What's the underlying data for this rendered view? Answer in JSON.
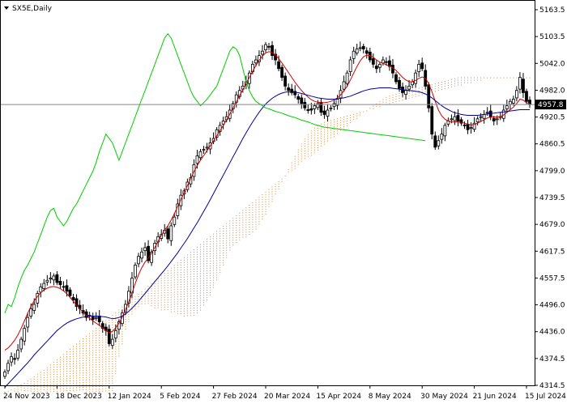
{
  "chart_data": {
    "type": "candlestick",
    "title": "SX5E,Daily",
    "current_price_label": "4957.8",
    "current_price": 4957.8,
    "ylim": [
      4314.5,
      5175.0
    ],
    "y_ticks": [
      "5163.5",
      "5103.5",
      "5042.0",
      "4982.0",
      "4920.5",
      "4860.5",
      "4799.0",
      "4739.5",
      "4679.0",
      "4617.5",
      "4557.5",
      "4496.0",
      "4436.0",
      "4374.5",
      "4314.5"
    ],
    "x_ticks": [
      "24 Nov 2023",
      "18 Dec 2023",
      "12 Jan 2024",
      "5 Feb 2024",
      "27 Feb 2024",
      "20 Mar 2024",
      "15 Apr 2024",
      "8 May 2024",
      "30 May 2024",
      "21 Jun 2024",
      "15 Jul 2024"
    ],
    "x_tick_bars": [
      0,
      16,
      32,
      48,
      64,
      80,
      96,
      112,
      128,
      144,
      160
    ],
    "bar_count": 162,
    "closes": [
      4345,
      4365,
      4380,
      4374,
      4395,
      4420,
      4445,
      4470,
      4490,
      4500,
      4525,
      4540,
      4548,
      4555,
      4560,
      4565,
      4550,
      4545,
      4540,
      4530,
      4520,
      4510,
      4495,
      4490,
      4480,
      4470,
      4475,
      4465,
      4470,
      4460,
      4445,
      4440,
      4410,
      4420,
      4440,
      4460,
      4480,
      4500,
      4530,
      4560,
      4590,
      4610,
      4620,
      4630,
      4600,
      4620,
      4640,
      4655,
      4660,
      4670,
      4650,
      4680,
      4700,
      4730,
      4750,
      4760,
      4780,
      4790,
      4820,
      4840,
      4850,
      4855,
      4860,
      4870,
      4880,
      4900,
      4910,
      4920,
      4930,
      4945,
      4960,
      4980,
      4990,
      5000,
      5010,
      5030,
      5050,
      5060,
      5070,
      5080,
      5095,
      5090,
      5070,
      5060,
      5040,
      5020,
      5000,
      4990,
      4985,
      4980,
      4970,
      4960,
      4950,
      4945,
      4945,
      4955,
      4960,
      4940,
      4935,
      4945,
      4950,
      4960,
      4970,
      4990,
      5010,
      5030,
      5060,
      5080,
      5085,
      5088,
      5085,
      5075,
      5060,
      5050,
      5040,
      5050,
      5060,
      5055,
      5045,
      5030,
      5010,
      4995,
      4985,
      4990,
      5000,
      5010,
      5030,
      5050,
      5040,
      5000,
      4950,
      4890,
      4860,
      4875,
      4890,
      4910,
      4920,
      4925,
      4930,
      4920,
      4915,
      4910,
      4900,
      4905,
      4915,
      4925,
      4930,
      4935,
      4940,
      4930,
      4920,
      4925,
      4930,
      4945,
      4955,
      4965,
      4970,
      4990,
      5020,
      4985,
      4965,
      4957.8
    ],
    "series": [
      {
        "name": "Tenkan-sen",
        "color": "#cc0000",
        "values": [
          4395,
          4400,
          4408,
          4418,
          4430,
          4445,
          4462,
          4480,
          4495,
          4508,
          4518,
          4527,
          4533,
          4537,
          4540,
          4541,
          4539,
          4536,
          4531,
          4524,
          4516,
          4507,
          4498,
          4490,
          4482,
          4474,
          4468,
          4462,
          4457,
          4452,
          4446,
          4440,
          4435,
          4438,
          4446,
          4457,
          4471,
          4488,
          4506,
          4526,
          4548,
          4568,
          4584,
          4597,
          4606,
          4617,
          4630,
          4645,
          4658,
          4670,
          4680,
          4693,
          4708,
          4724,
          4740,
          4756,
          4772,
          4788,
          4804,
          4818,
          4830,
          4841,
          4852,
          4863,
          4874,
          4886,
          4898,
          4910,
          4923,
          4936,
          4950,
          4964,
          4978,
          4992,
          5006,
          5020,
          5034,
          5047,
          5059,
          5069,
          5076,
          5079,
          5077,
          5071,
          5063,
          5053,
          5042,
          5031,
          5020,
          5009,
          4999,
          4990,
          4982,
          4975,
          4969,
          4965,
          4963,
          4962,
          4962,
          4963,
          4965,
          4968,
          4973,
          4980,
          4989,
          5000,
          5014,
          5030,
          5045,
          5058,
          5067,
          5071,
          5070,
          5066,
          5060,
          5055,
          5052,
          5049,
          5046,
          5042,
          5036,
          5028,
          5020,
          5014,
          5010,
          5010,
          5013,
          5018,
          5021,
          5018,
          5006,
          4987,
          4965,
          4945,
          4932,
          4924,
          4920,
          4918,
          4918,
          4918,
          4917,
          4915,
          4913,
          4911,
          4912,
          4915,
          4919,
          4923,
          4927,
          4929,
          4929,
          4929,
          4930,
          4934,
          4940,
          4946,
          4952,
          4960,
          4970,
          4968,
          4962,
          4960
        ]
      },
      {
        "name": "Kijun-sen",
        "color": "#000099",
        "values": [
          4310,
          4318,
          4326,
          4334,
          4342,
          4350,
          4358,
          4366,
          4375,
          4384,
          4392,
          4400,
          4408,
          4416,
          4424,
          4432,
          4440,
          4446,
          4452,
          4457,
          4461,
          4464,
          4467,
          4469,
          4471,
          4472,
          4473,
          4473,
          4473,
          4473,
          4472,
          4471,
          4469,
          4467,
          4468,
          4470,
          4473,
          4478,
          4484,
          4491,
          4499,
          4507,
          4516,
          4525,
          4534,
          4543,
          4552,
          4561,
          4570,
          4579,
          4588,
          4598,
          4608,
          4618,
          4629,
          4640,
          4651,
          4663,
          4675,
          4687,
          4700,
          4713,
          4726,
          4740,
          4754,
          4768,
          4782,
          4796,
          4810,
          4824,
          4838,
          4852,
          4866,
          4880,
          4893,
          4906,
          4918,
          4929,
          4940,
          4950,
          4959,
          4966,
          4972,
          4977,
          4981,
          4984,
          4986,
          4987,
          4987,
          4986,
          4985,
          4983,
          4981,
          4979,
          4977,
          4975,
          4973,
          4972,
          4971,
          4970,
          4970,
          4970,
          4971,
          4972,
          4973,
          4975,
          4977,
          4980,
          4983,
          4986,
          4989,
          4991,
          4993,
          4994,
          4995,
          4996,
          4996,
          4996,
          4996,
          4995,
          4994,
          4993,
          4992,
          4991,
          4990,
          4989,
          4988,
          4987,
          4985,
          4982,
          4978,
          4973,
          4967,
          4961,
          4955,
          4950,
          4946,
          4942,
          4939,
          4937,
          4935,
          4934,
          4933,
          4933,
          4933,
          4933,
          4934,
          4935,
          4936,
          4937,
          4938,
          4939,
          4940,
          4941,
          4942,
          4943,
          4944,
          4945,
          4946,
          4946,
          4946,
          4946
        ]
      },
      {
        "name": "Chikou Span",
        "color": "#00cc00",
        "values": [
          4480,
          4500,
          4495,
          4515,
          4540,
          4560,
          4578,
          4590,
          4605,
          4620,
          4640,
          4660,
          4680,
          4700,
          4715,
          4720,
          4700,
          4690,
          4680,
          4690,
          4705,
          4720,
          4730,
          4745,
          4760,
          4775,
          4790,
          4805,
          4825,
          4850,
          4870,
          4890,
          4880,
          4870,
          4850,
          4830,
          4850,
          4870,
          4890,
          4910,
          4930,
          4950,
          4970,
          4990,
          5010,
          5030,
          5050,
          5070,
          5090,
          5110,
          5120,
          5110,
          5090,
          5070,
          5050,
          5030,
          5010,
          4990,
          4975,
          4965,
          4955,
          4962,
          4970,
          4980,
          4990,
          5000,
          5020,
          5040,
          5060,
          5080,
          5090,
          5085,
          5070,
          5040,
          5010,
          4990,
          4975,
          4965,
          4960,
          4955,
          4950,
          4948,
          4945,
          4942,
          4940,
          4938,
          4935,
          4932,
          4930,
          4928,
          4925,
          4922,
          4920,
          4918,
          4915,
          4912,
          4910,
          4908,
          4906,
          4905,
          4904,
          4903,
          4902,
          4901,
          4900,
          4899,
          4898,
          4897,
          4896,
          4895,
          4894,
          4893,
          4892,
          4891,
          4890,
          4889,
          4888,
          4887,
          4886,
          4885,
          4884,
          4883,
          4882,
          4881,
          4880,
          4879,
          4878,
          4877,
          4876,
          4875
        ]
      },
      {
        "name": "Senkou Span A",
        "color": "#d4883a",
        "values": [
          4300,
          4302,
          4305,
          4308,
          4312,
          4316,
          4320,
          4325,
          4330,
          4335,
          4340,
          4345,
          4350,
          4356,
          4362,
          4368,
          4374,
          4380,
          4386,
          4392,
          4398,
          4404,
          4410,
          4416,
          4422,
          4428,
          4434,
          4440,
          4446,
          4452,
          4458,
          4464,
          4470,
          4476,
          4482,
          4488,
          4494,
          4500,
          4506,
          4512,
          4518,
          4524,
          4530,
          4536,
          4542,
          4548,
          4554,
          4560,
          4566,
          4572,
          4578,
          4584,
          4590,
          4596,
          4602,
          4608,
          4614,
          4620,
          4626,
          4632,
          4638,
          4644,
          4650,
          4656,
          4662,
          4668,
          4674,
          4680,
          4686,
          4692,
          4698,
          4704,
          4710,
          4716,
          4722,
          4728,
          4734,
          4740,
          4746,
          4752,
          4758,
          4764,
          4770,
          4776,
          4782,
          4788,
          4794,
          4800,
          4806,
          4812,
          4818,
          4824,
          4830,
          4836,
          4842,
          4848,
          4854,
          4860,
          4866,
          4872,
          4878,
          4884,
          4890,
          4896,
          4902,
          4908,
          4914,
          4920,
          4926,
          4932,
          4938,
          4944,
          4950,
          4955,
          4960,
          4965,
          4970,
          4975,
          4978,
          4980,
          4982,
          4984,
          4986,
          4988,
          4990,
          4992,
          4994,
          4996,
          4998,
          5000,
          5002,
          5004,
          5006,
          5008,
          5010,
          5012,
          5014,
          5016,
          5018,
          5020,
          5020,
          5020,
          5020,
          5020,
          5020,
          5020,
          5020,
          5020,
          5020,
          5020,
          5020,
          5020,
          5020,
          5020,
          5020,
          5020,
          5020,
          5020,
          5020,
          5020,
          5020,
          5020
        ]
      },
      {
        "name": "Senkou Span B",
        "color": "#d4883a",
        "values": [
          4300,
          4300,
          4300,
          4300,
          4300,
          4300,
          4300,
          4300,
          4300,
          4300,
          4300,
          4300,
          4300,
          4300,
          4300,
          4300,
          4300,
          4300,
          4300,
          4300,
          4300,
          4300,
          4300,
          4300,
          4300,
          4300,
          4300,
          4300,
          4300,
          4300,
          4300,
          4300,
          4300,
          4300,
          4340,
          4380,
          4410,
          4440,
          4460,
          4475,
          4488,
          4496,
          4500,
          4502,
          4500,
          4495,
          4492,
          4490,
          4488,
          4486,
          4484,
          4482,
          4480,
          4478,
          4476,
          4474,
          4472,
          4470,
          4472,
          4478,
          4486,
          4496,
          4508,
          4522,
          4538,
          4555,
          4572,
          4590,
          4608,
          4622,
          4632,
          4640,
          4646,
          4650,
          4652,
          4656,
          4662,
          4670,
          4680,
          4692,
          4706,
          4720,
          4735,
          4750,
          4765,
          4780,
          4795,
          4810,
          4825,
          4840,
          4855,
          4868,
          4880,
          4890,
          4898,
          4905,
          4910,
          4914,
          4918,
          4920,
          4922,
          4924,
          4926,
          4928,
          4930,
          4932,
          4934,
          4936,
          4938,
          4940,
          4942,
          4944,
          4946,
          4948,
          4950,
          4952,
          4954,
          4956,
          4958,
          4960,
          4962,
          4964,
          4966,
          4968,
          4970,
          4972,
          4974,
          4976,
          4978,
          4980,
          4982,
          4984,
          4986,
          4988,
          4990,
          4992,
          4994,
          4996,
          4998,
          5000,
          5002,
          5004,
          5006,
          5008,
          5010,
          5012,
          5014,
          5016,
          5018,
          5020,
          5020,
          5020,
          5020,
          5020,
          5020,
          5020,
          5020,
          5020,
          5020,
          5020,
          5020,
          5020
        ]
      }
    ],
    "grid": false,
    "background": "#ffffff"
  }
}
